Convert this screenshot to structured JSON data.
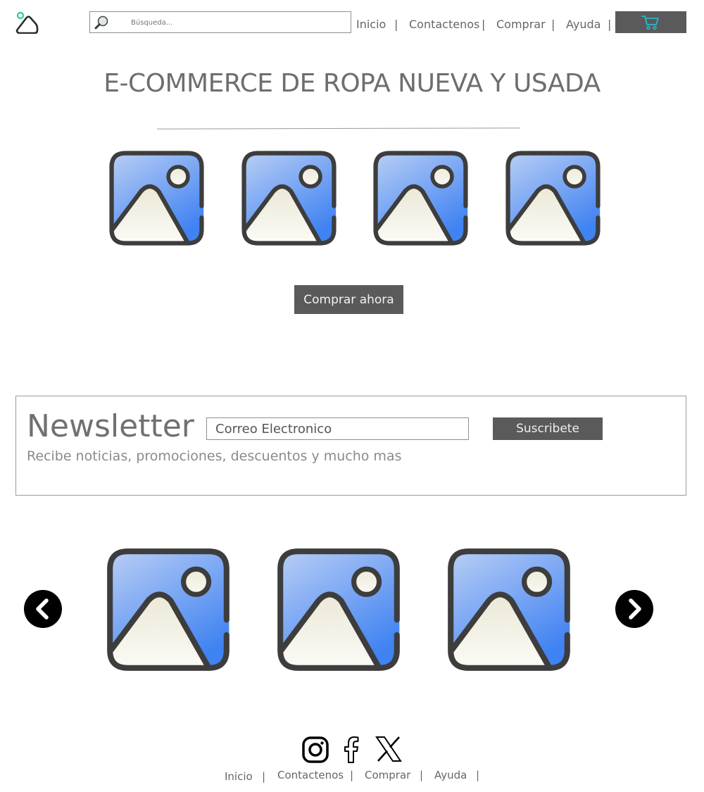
{
  "header": {
    "search_placeholder": "Búsqueda...",
    "nav": [
      "Inicio",
      "Contactenos",
      "Comprar",
      "Ayuda"
    ],
    "separator": "|"
  },
  "hero": {
    "title": "E-COMMERCE DE ROPA NUEVA Y USADA",
    "buy_button": "Comprar ahora"
  },
  "newsletter": {
    "title": "Newsletter",
    "subtitle": "Recibe noticias, promociones, descuentos y mucho mas",
    "email_placeholder": "Correo Electronico",
    "subscribe_button": "Suscribete"
  },
  "footer": {
    "social_icons": [
      "instagram-icon",
      "facebook-icon",
      "x-icon"
    ],
    "nav": [
      "Inicio",
      "Contactenos",
      "Comprar",
      "Ayuda"
    ],
    "separator": "|"
  },
  "colors": {
    "button_bg": "#5a5a5a",
    "cart_icon": "#2bb6c9",
    "logo_accent": "#3ccf9f",
    "image_blue": "#4a86f0"
  }
}
